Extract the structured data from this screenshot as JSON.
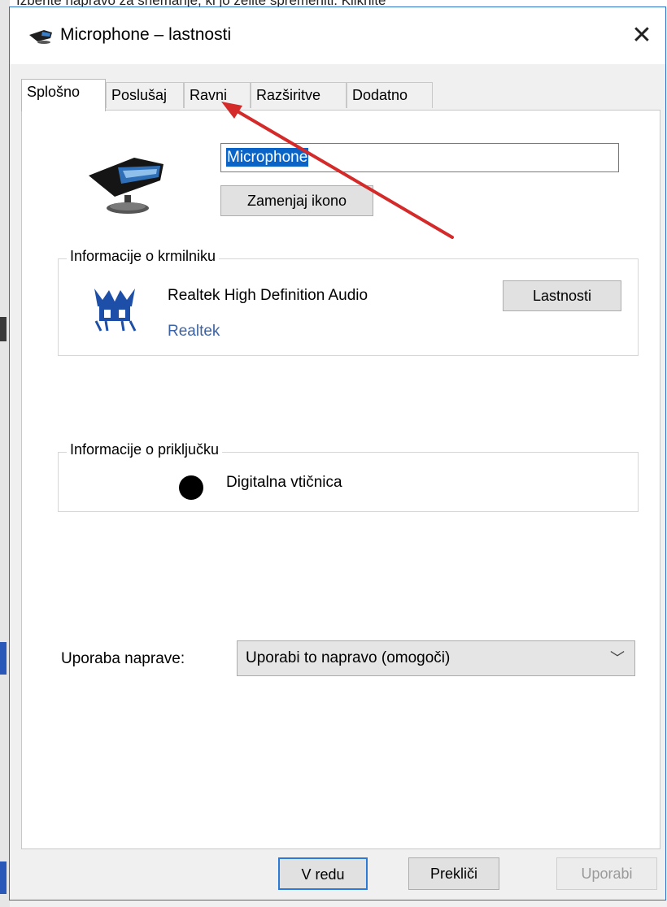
{
  "background_text": "Izberite napravo za snemanje, ki jo želite spremeniti. Kliknite",
  "window": {
    "title": "Microphone – lastnosti",
    "close_glyph": "✕"
  },
  "tabs": [
    {
      "label": "Splošno",
      "active": true
    },
    {
      "label": "Poslušaj",
      "active": false
    },
    {
      "label": "Ravni",
      "active": false
    },
    {
      "label": "Razširitve",
      "active": false
    },
    {
      "label": "Dodatno",
      "active": false
    }
  ],
  "device": {
    "icon": "microphone-device-icon",
    "name_value": "Microphone",
    "change_icon_label": "Zamenjaj ikono"
  },
  "controller": {
    "group_label": "Informacije o krmilniku",
    "logo": "realtek-logo-icon",
    "name": "Realtek High Definition Audio",
    "vendor": "Realtek",
    "properties_label": "Lastnosti"
  },
  "jack": {
    "group_label": "Informacije o priključku",
    "icon": "jack-dot-icon",
    "label": "Digitalna vtičnica"
  },
  "usage": {
    "label": "Uporaba naprave:",
    "selected": "Uporabi to napravo (omogoči)",
    "chevron": "﹀"
  },
  "footer": {
    "ok_label": "V redu",
    "cancel_label": "Prekliči",
    "apply_label": "Uporabi"
  },
  "colors": {
    "annotation_arrow": "#d42a2a",
    "selection": "#0a64c8",
    "link": "#3b64a6",
    "dialog_border": "#2b6ec8"
  }
}
